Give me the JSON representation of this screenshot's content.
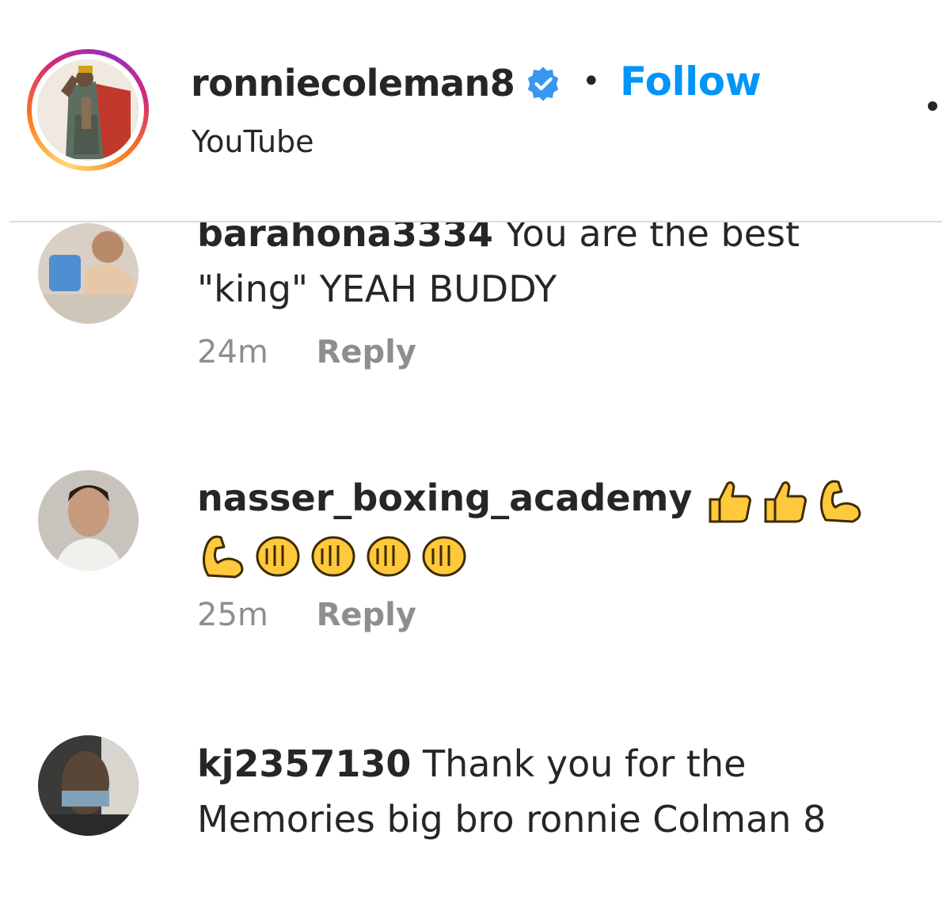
{
  "post_header": {
    "username": "ronniecoleman8",
    "follow_label": "Follow",
    "separator": "•",
    "subtitle": "YouTube",
    "verified_icon": "verified-badge-icon",
    "more_icon": "more-options-icon"
  },
  "comments": [
    {
      "username": "barahona3334",
      "text": "You are the best \"king\" YEAH BUDDY",
      "time": "24m",
      "reply_label": "Reply"
    },
    {
      "username": "nasser_boxing_academy",
      "emojis": [
        "thumbs-up-icon",
        "thumbs-up-icon",
        "flexed-biceps-icon",
        "flexed-biceps-icon",
        "oncoming-fist-icon",
        "oncoming-fist-icon",
        "oncoming-fist-icon",
        "oncoming-fist-icon"
      ],
      "time": "25m",
      "reply_label": "Reply"
    },
    {
      "username": "kj2357130",
      "text": "Thank you for the Memories big bro ronnie Colman 8",
      "time": "",
      "reply_label": ""
    }
  ],
  "colors": {
    "accent": "#0095f6",
    "text": "#262626",
    "secondary_text": "#8e8e8e",
    "emoji_yellow": "#ffc83d"
  }
}
